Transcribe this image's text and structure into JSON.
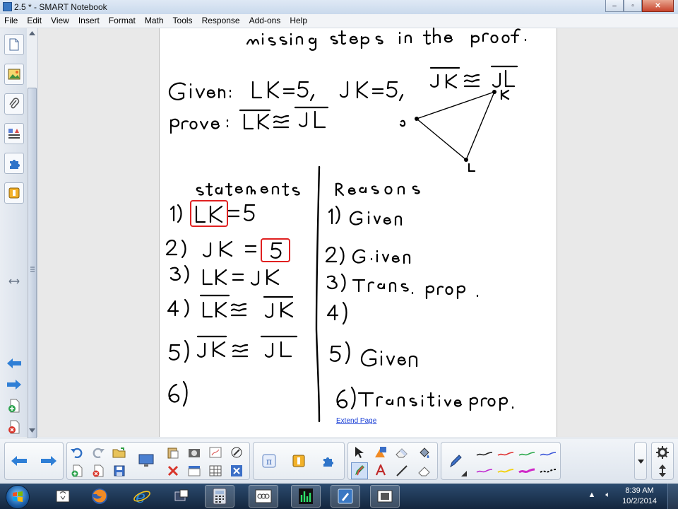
{
  "window": {
    "title": "2.5 * - SMART Notebook",
    "minimize_glyph": "‒",
    "maximize_glyph": "▫",
    "close_glyph": "✕"
  },
  "menu": [
    "File",
    "Edit",
    "View",
    "Insert",
    "Format",
    "Math",
    "Tools",
    "Response",
    "Add-ons",
    "Help"
  ],
  "sidebar": {
    "tabs": [
      "page-sorter-icon",
      "gallery-icon",
      "attachments-icon",
      "properties-icon",
      "add-ons-icon",
      "response-icon"
    ],
    "arrows": [
      "previous-page-icon",
      "next-page-icon"
    ],
    "bottom_icons": [
      "add-page-icon",
      "delete-page-icon"
    ]
  },
  "page": {
    "extend_label": "Extend Page",
    "ink_color": "#000000",
    "highlight_color": "#e02020"
  },
  "toolbar": {
    "accent": "#2a6fd1",
    "pen_colors": [
      "#222222",
      "#e03030",
      "#2aa84a",
      "#3a55d8",
      "#c02ad0",
      "#f2d21a",
      "#d02ac8",
      "#111111"
    ]
  },
  "taskbar": {
    "apps": [
      "smart-board-icon",
      "firefox-icon",
      "internet-explorer-icon",
      "smart-tools-icon",
      "calculator-icon",
      "recorder-icon",
      "audio-meter-icon",
      "smart-notebook-icon",
      "screen-capture-icon"
    ],
    "time": "8:39 AM",
    "date": "10/2/2014",
    "show_hidden_glyph": "▲",
    "volume_glyph": "🔈︎"
  }
}
